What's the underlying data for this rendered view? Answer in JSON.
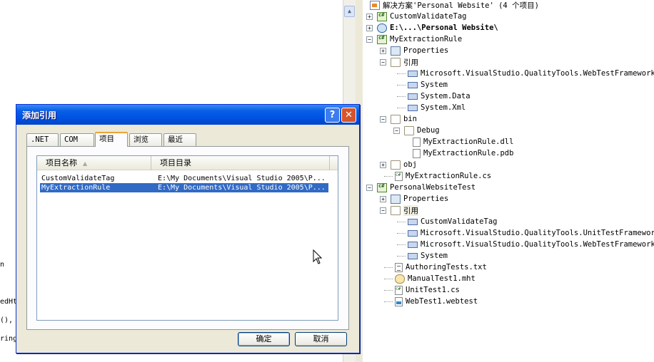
{
  "editor": {
    "code_fragments": [
      "n",
      "edHt",
      "(), ;",
      "ring"
    ]
  },
  "solution": {
    "root": "解决方案'Personal Website' (4 个项目)",
    "nodes": [
      "CustomValidateTag",
      "E:\\...\\Personal Website\\",
      "MyExtractionRule",
      "Properties",
      "引用",
      "Microsoft.VisualStudio.QualityTools.WebTestFramework",
      "System",
      "System.Data",
      "System.Xml",
      "bin",
      "Debug",
      "MyExtractionRule.dll",
      "MyExtractionRule.pdb",
      "obj",
      "MyExtractionRule.cs",
      "PersonalWebsiteTest",
      "Properties",
      "引用",
      "CustomValidateTag",
      "Microsoft.VisualStudio.QualityTools.UnitTestFramework",
      "Microsoft.VisualStudio.QualityTools.WebTestFramework",
      "System",
      "AuthoringTests.txt",
      "ManualTest1.mht",
      "UnitTest1.cs",
      "WebTest1.webtest"
    ]
  },
  "dialog": {
    "title": "添加引用",
    "help_glyph": "?",
    "close_glyph": "✕",
    "tabs": [
      ".NET",
      "COM",
      "项目",
      "浏览",
      "最近"
    ],
    "columns": [
      "项目名称",
      "项目目录"
    ],
    "rows": [
      {
        "name": "CustomValidateTag",
        "dir": "E:\\My Documents\\Visual Studio 2005\\P..."
      },
      {
        "name": "MyExtractionRule",
        "dir": "E:\\My Documents\\Visual Studio 2005\\P..."
      }
    ],
    "ok_label": "确定",
    "cancel_label": "取消"
  }
}
